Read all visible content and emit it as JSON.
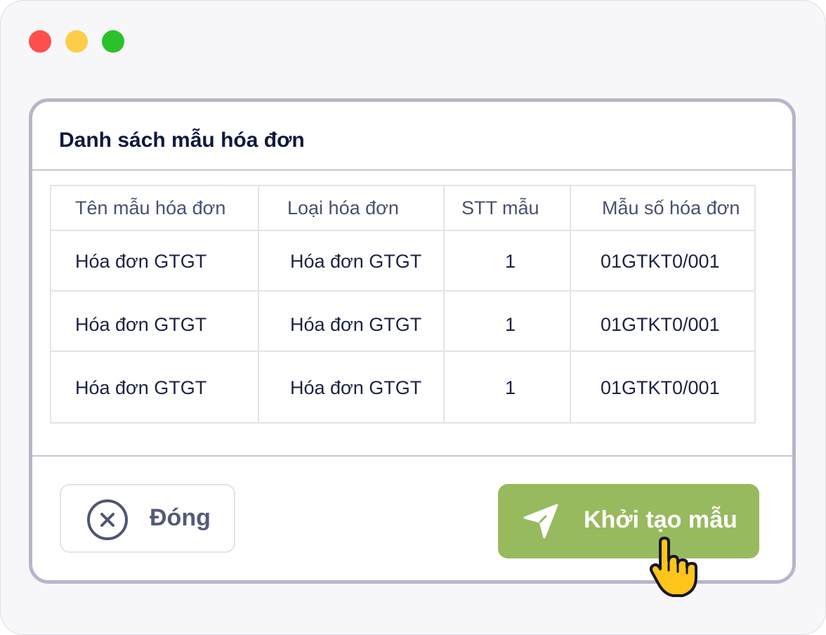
{
  "dialog": {
    "title": "Danh sách mẫu hóa đơn",
    "table": {
      "headers": [
        "Tên mẫu hóa đơn",
        "Loại hóa đơn",
        "STT mẫu",
        "Mẫu số hóa đơn"
      ],
      "rows": [
        [
          "Hóa đơn GTGT",
          "Hóa đơn GTGT",
          "1",
          "01GTKT0/001"
        ],
        [
          "Hóa đơn GTGT",
          "Hóa đơn GTGT",
          "1",
          "01GTKT0/001"
        ],
        [
          "Hóa đơn GTGT",
          "Hóa đơn GTGT",
          "1",
          "01GTKT0/001"
        ]
      ]
    },
    "close_label": "Đóng",
    "create_label": "Khởi tạo mẫu"
  },
  "icons": {
    "close": "close-circle-icon",
    "create": "send-icon",
    "cursor": "hand-pointer-icon"
  },
  "colors": {
    "primary_button": "#97ba5e",
    "window_close": "#fe4f4f",
    "window_minimize": "#fdcd4a",
    "window_maximize": "#2ac12a"
  }
}
